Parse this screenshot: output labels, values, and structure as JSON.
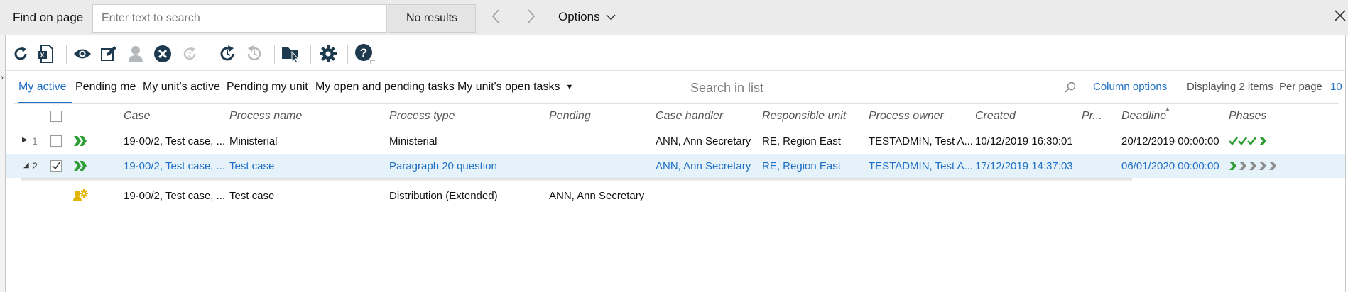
{
  "findbar": {
    "label": "Find on page",
    "placeholder": "Enter text to search",
    "value": "",
    "results": "No results",
    "prev_icon": "chevron-left-icon",
    "next_icon": "chevron-right-icon",
    "options_label": "Options",
    "close_icon": "close-icon"
  },
  "toolbar": {
    "icons": [
      "refresh-icon",
      "excel-export-icon",
      "view-icon",
      "edit-icon",
      "user-icon",
      "cancel-icon",
      "disabled-refresh-icon",
      "restart-icon",
      "history-icon",
      "folder-open-icon",
      "settings-icon",
      "help-icon"
    ]
  },
  "tabs": {
    "items": [
      {
        "label": "My active",
        "active": true
      },
      {
        "label": "Pending me",
        "active": false
      },
      {
        "label": "My unit's active",
        "active": false
      },
      {
        "label": "Pending my unit",
        "active": false
      },
      {
        "label": "My open and pending tasks",
        "active": false
      },
      {
        "label": "My unit's open tasks",
        "active": false
      }
    ],
    "search_placeholder": "Search in list",
    "column_options": "Column options",
    "displaying": "Displaying 2 items",
    "per_page_label": "Per page",
    "per_page_value": "10"
  },
  "table": {
    "headers": {
      "case": "Case",
      "process_name": "Process name",
      "process_type": "Process type",
      "pending": "Pending",
      "case_handler": "Case handler",
      "responsible_unit": "Responsible unit",
      "process_owner": "Process owner",
      "created": "Created",
      "priority": "Pr...",
      "deadline": "Deadline",
      "phases": "Phases"
    },
    "rows": [
      {
        "num": "1",
        "checked": false,
        "case": "19-00/2, Test case, ...",
        "process_name": "Ministerial",
        "process_type": "Ministerial",
        "pending": "",
        "case_handler": "ANN, Ann Secretary",
        "responsible_unit": "RE, Region East",
        "process_owner": "TESTADMIN, Test A...",
        "created": "10/12/2019 16:30:01",
        "priority": "",
        "deadline": "20/12/2019 00:00:00",
        "phases": "completed"
      },
      {
        "num": "2",
        "checked": true,
        "case": "19-00/2, Test case, ...",
        "process_name": "Test case",
        "process_type": "Paragraph 20 question",
        "pending": "",
        "case_handler": "ANN, Ann Secretary",
        "responsible_unit": "RE, Region East",
        "process_owner": "TESTADMIN, Test A...",
        "created": "17/12/2019 14:37:03",
        "priority": "",
        "deadline": "06/01/2020 00:00:00",
        "phases": "in-progress"
      },
      {
        "num": "",
        "checked": false,
        "case": "19-00/2, Test case, ...",
        "process_name": "Test case",
        "process_type": "Distribution (Extended)",
        "pending": "ANN, Ann Secretary",
        "case_handler": "",
        "responsible_unit": "",
        "process_owner": "",
        "created": "",
        "priority": "",
        "deadline": "",
        "phases": ""
      }
    ]
  },
  "colors": {
    "accent": "#1f6fc4",
    "selected_row": "#e6f2fa",
    "phase_green": "#2e9e34",
    "phase_grey": "#8c8c8c",
    "task_icon_yellow": "#e0b400"
  }
}
